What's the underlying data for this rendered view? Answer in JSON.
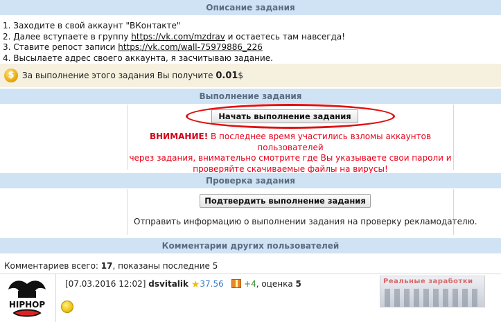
{
  "task_description": {
    "header": "Описание задания",
    "step1": "1. Заходите в свой аккаунт \"ВКонтакте\"",
    "step2_prefix": "2. Далее вступаете в группу ",
    "step2_link": "https://vk.com/mzdrav",
    "step2_suffix": " и остаетесь там навсегда!",
    "step3_prefix": "3. Ставите репост записи ",
    "step3_link": "https://vk.com/wall-75979886_226",
    "step4": "4. Высылаете адрес своего аккаунта, я засчитываю задание."
  },
  "reward": {
    "coin_icon": "$",
    "text_prefix": "За выполнение этого задания Вы получите ",
    "amount": "0.01",
    "currency": "$"
  },
  "execution": {
    "header": "Выполнение задания",
    "start_button": "Начать выполнение задания",
    "warning_label": "ВНИМАНИЕ!",
    "warning_text_line1": " В последнее время участились взломы аккаунтов пользователей",
    "warning_text_line2": "через задания, внимательно смотрите где Вы указываете свои пароли и",
    "warning_text_line3": "проверяйте скачиваемые файлы на вирусы!"
  },
  "verification": {
    "header": "Проверка задания",
    "confirm_button": "Подтвердить выполнение задания",
    "info": "Отправить информацию о выполнении задания на проверку рекламодателю."
  },
  "comments": {
    "header": "Комментарии других пользователей",
    "total_prefix": "Комментариев всего: ",
    "total": "17",
    "shown_text": ", показаны последние 5",
    "items": [
      {
        "date": "[07.03.2016 12:02]",
        "user": "dsvitalik",
        "rating": "37.56",
        "plus": "+4",
        "score_label": ", оценка ",
        "score": "5"
      }
    ]
  },
  "avatar": {
    "text": "HIPHOP"
  },
  "banner": {
    "text": "Реальные заработки"
  },
  "colors": {
    "section_header_bg": "#cfe3f5",
    "section_header_text": "#5a6b80",
    "reward_bg": "#f6f0df",
    "warning_red": "#e8001a",
    "highlight_oval": "#e01010"
  }
}
